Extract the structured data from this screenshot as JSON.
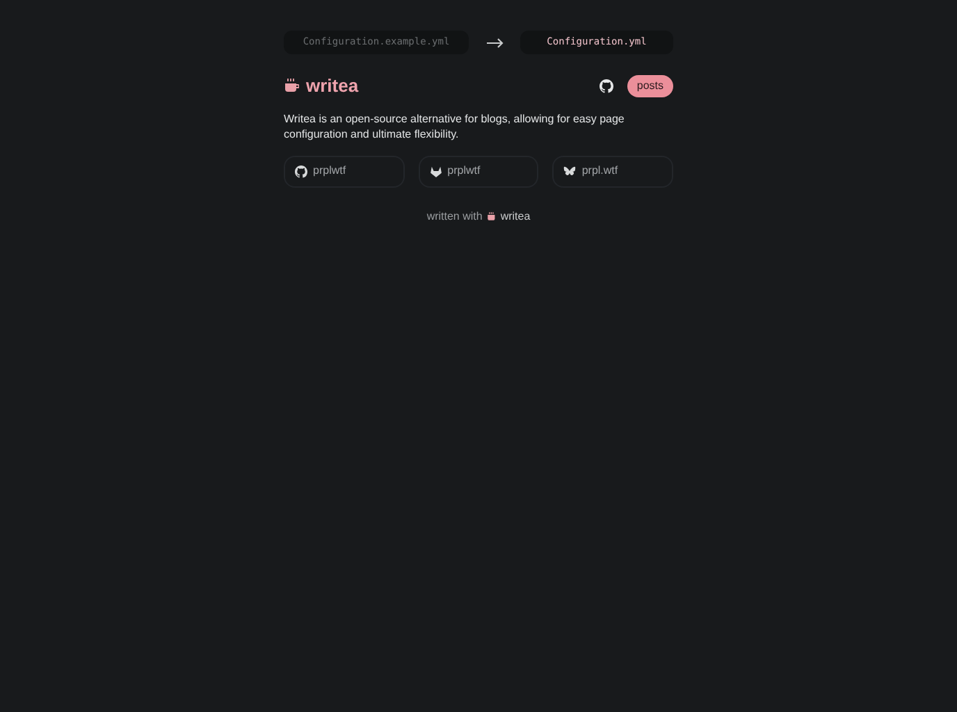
{
  "config_hint": {
    "source": "Configuration.example.yml",
    "target": "Configuration.yml"
  },
  "header": {
    "title": "writea",
    "nav": [
      {
        "kind": "github"
      },
      {
        "kind": "button",
        "label": "posts"
      }
    ]
  },
  "description": "Writea is an open-source alternative for blogs, allowing for easy page configuration and ultimate flexibility.",
  "links": [
    {
      "kind": "github",
      "label": "prplwtf"
    },
    {
      "kind": "gitlab",
      "label": "prplwtf"
    },
    {
      "kind": "bluesky",
      "label": "prpl.wtf"
    }
  ],
  "footer": {
    "prefix": "written with",
    "brand": "writea"
  }
}
